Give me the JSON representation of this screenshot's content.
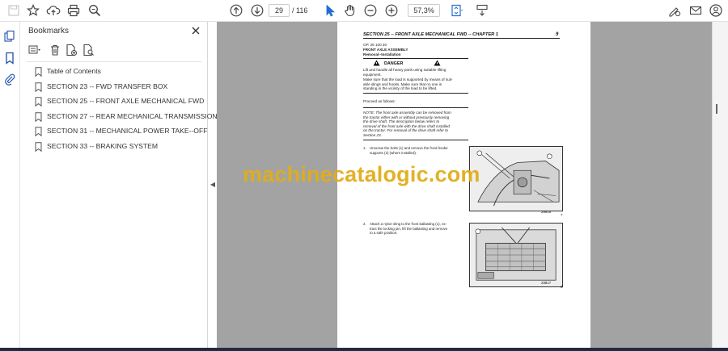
{
  "toolbar": {
    "current_page": "29",
    "page_separator": "/ 116",
    "zoom": "57,3%"
  },
  "bookmarks": {
    "title": "Bookmarks",
    "items": [
      {
        "label": "Table of Contents"
      },
      {
        "label": "SECTION 23 -- FWD TRANSFER BOX"
      },
      {
        "label": "SECTION 25 -- FRONT AXLE MECHANICAL FWD"
      },
      {
        "label": "SECTION 27 -- REAR MECHANICAL TRANSMISSION"
      },
      {
        "label": "SECTION 31 -- MECHANICAL POWER TAKE--OFF"
      },
      {
        "label": "SECTION 33 -- BRAKING SYSTEM"
      }
    ]
  },
  "document": {
    "header": "SECTION 25 -- FRONT AXLE MECHANICAL FWD -- CHAPTER 1",
    "page_number": "9",
    "op_code": "OP. 25 100 30",
    "heading": "FRONT AXLE ASSEMBLY",
    "subheading": "Removal--Installation",
    "danger": "DANGER",
    "danger_text_1": "Lift and handle all heavy parts using suitable lifting",
    "danger_text_2": "equipment.",
    "danger_text_3": "Make sure that the load is supported by means of suit-",
    "danger_text_4": "able slings and hooks. Make sure that no one is",
    "danger_text_5": "standing in the vicinity of the load to be lifted.",
    "proceed": "Proceed as follows:",
    "note_1": "NOTE: The front axle assembly can be removed from",
    "note_2": "the tractor either with or without previously removing",
    "note_3": "the drive shaft. The description below refers to",
    "note_4": "removal of the front axle with the drive shaft installed",
    "note_5": "on the tractor. For removal of the drive shaft refer to",
    "note_6": "Section 23.",
    "step1_num": "1.",
    "step1_text_a": "Unscrew the bolts (1) and remove the front fender",
    "step1_text_b": "supports (2) (where installed).",
    "step2_num": "2.",
    "step2_text_a": "Attach a nylon sling to the front ballasting (1), ex-",
    "step2_text_b": "tract the locking pin, lift the ballasting and remove",
    "step2_text_c": "to a safe position.",
    "fig1_num": "7",
    "fig2_num": "8",
    "fig1_code": "28815",
    "fig2_code": "28817"
  },
  "watermark": "machinecatalogic.com"
}
